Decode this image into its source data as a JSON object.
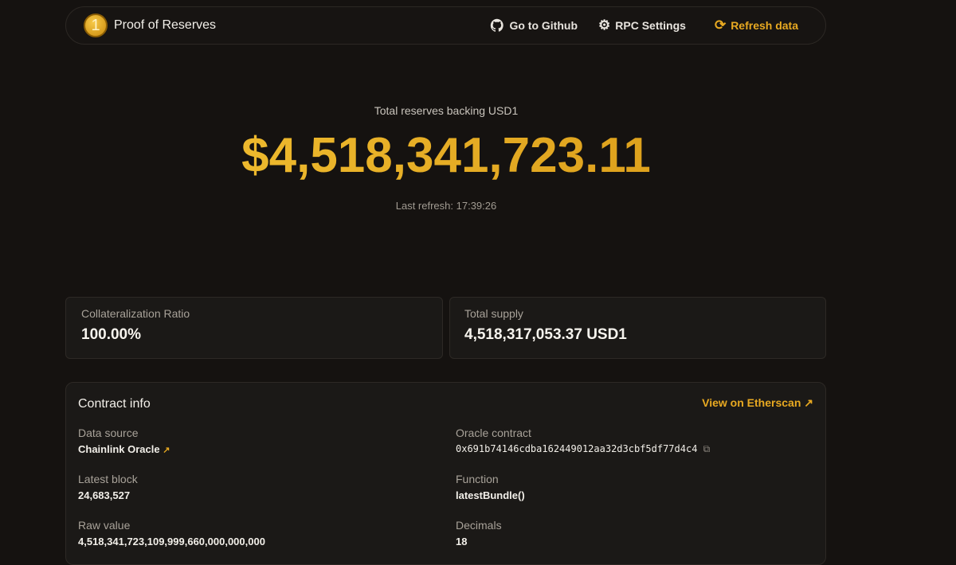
{
  "nav": {
    "logo_text": "1",
    "title": "Proof of Reserves",
    "github": "Go to Github",
    "rpc": "RPC Settings",
    "refresh": "Refresh data"
  },
  "hero": {
    "subtitle": "Total reserves backing USD1",
    "amount": "$4,518,341,723.11",
    "last_refresh": "Last refresh: 17:39:26"
  },
  "stats": [
    {
      "label": "Collateralization Ratio",
      "value": "100.00%"
    },
    {
      "label": "Total supply",
      "value": "4,518,317,053.37 USD1"
    }
  ],
  "contract": {
    "title": "Contract info",
    "etherscan": "View on Etherscan",
    "fields": [
      {
        "label": "Data source",
        "value": "Chainlink Oracle"
      },
      {
        "label": "Oracle contract",
        "value": "0x691b74146cdba162449012aa32d3cbf5df77d4c4"
      },
      {
        "label": "Latest block",
        "value": "24,683,527"
      },
      {
        "label": "Function",
        "value": "latestBundle()"
      },
      {
        "label": "Raw value",
        "value": "4,518,341,723,109,999,660,000,000,000"
      },
      {
        "label": "Decimals",
        "value": "18"
      }
    ]
  },
  "colors": {
    "accent": "#e8a921",
    "background": "#151210"
  }
}
